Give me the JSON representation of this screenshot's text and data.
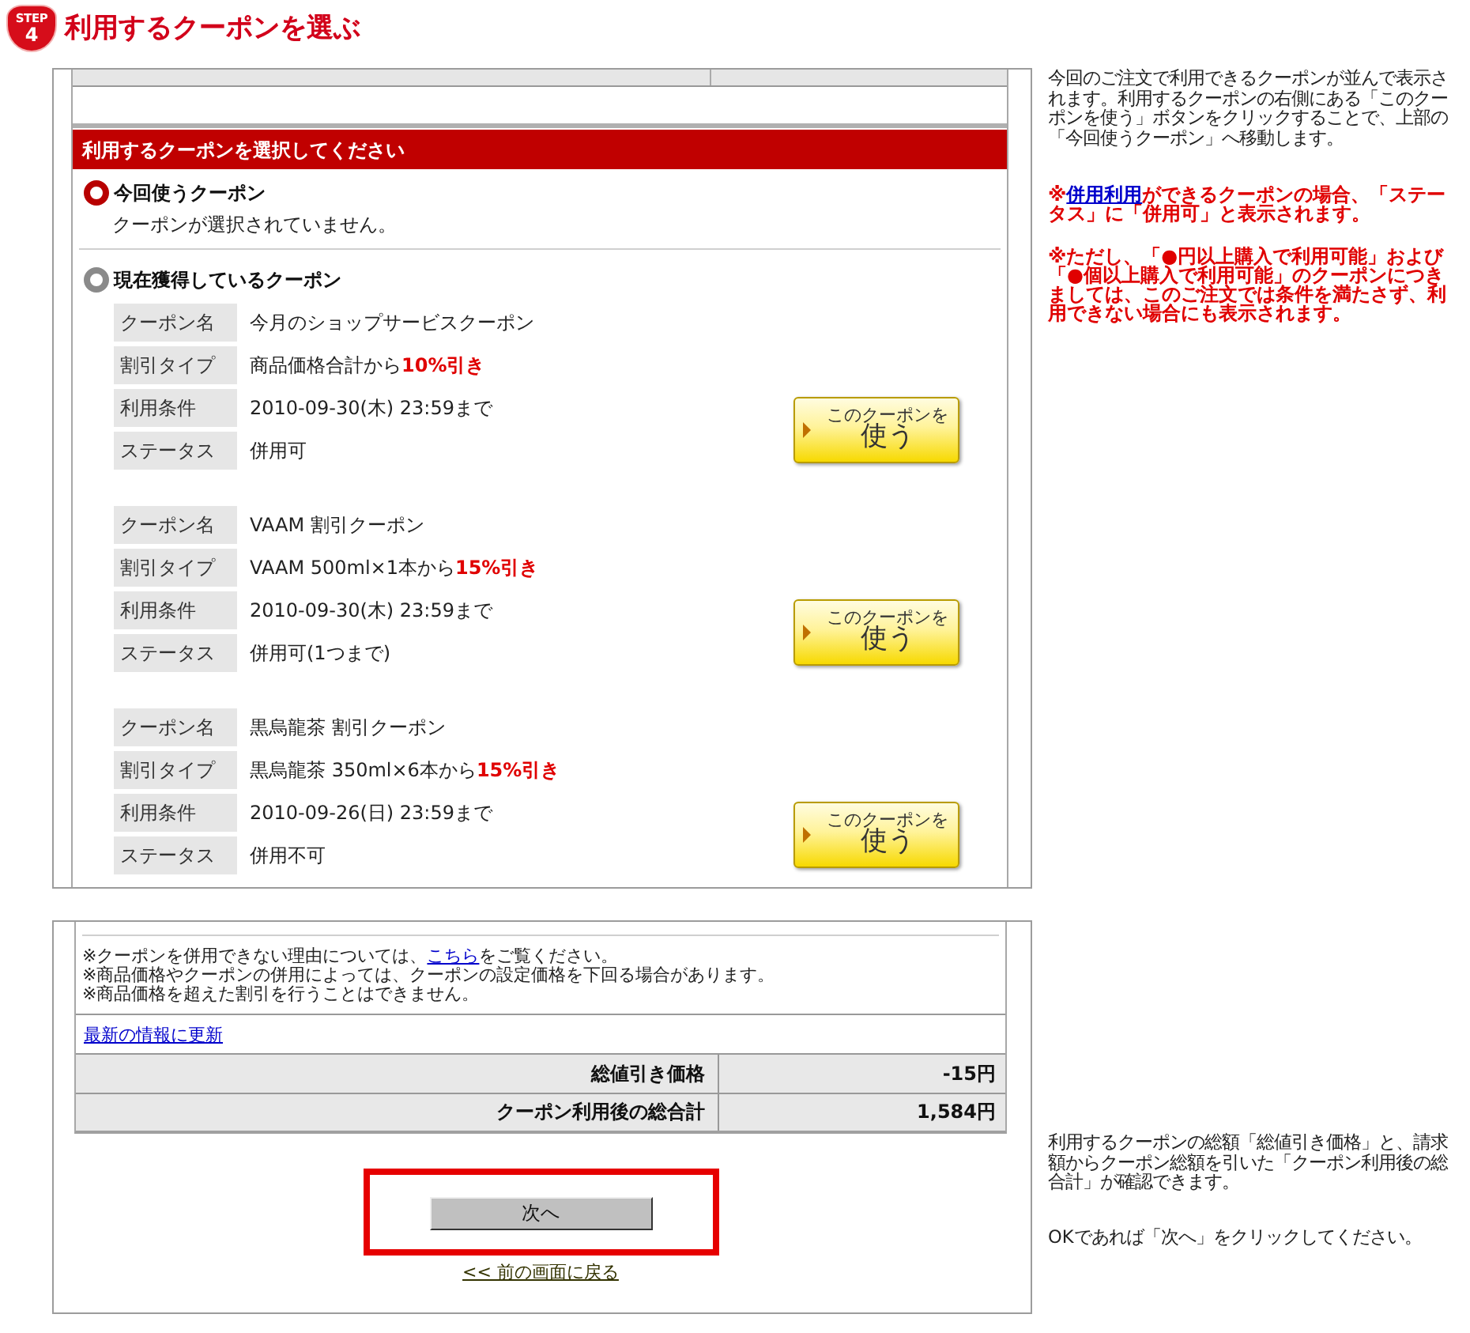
{
  "step": {
    "label": "STEP",
    "number": "4"
  },
  "title": "利用するクーポンを選ぶ",
  "coupon_panel": {
    "header": "利用するクーポンを選択してください",
    "options": [
      {
        "label": "今回使うクーポン",
        "selected": true,
        "message": "クーポンが選択されていません。"
      },
      {
        "label": "現在獲得しているクーポン",
        "selected": false,
        "coupons": [
          {
            "fields": [
              {
                "label": "クーポン名",
                "value": "今月のショップサービスクーポン"
              },
              {
                "label": "割引タイプ",
                "value": "商品価格合計から**10%引き**"
              },
              {
                "label": "利用条件",
                "value": "2010-09-30(木) 23:59まで"
              },
              {
                "label": "ステータス",
                "value": "併用可"
              }
            ],
            "button_lines": [
              "このクーポンを",
              "使う"
            ]
          },
          {
            "fields": [
              {
                "label": "クーポン名",
                "value": "VAAM 割引クーポン"
              },
              {
                "label": "割引タイプ",
                "value": "VAAM 500ml×1本から**15%引き**"
              },
              {
                "label": "利用条件",
                "value": "2010-09-30(木) 23:59まで"
              },
              {
                "label": "ステータス",
                "value": "併用可(1つまで)"
              }
            ],
            "button_lines": [
              "このクーポンを",
              "使う"
            ]
          },
          {
            "fields": [
              {
                "label": "クーポン名",
                "value": "黒烏龍茶 割引クーポン"
              },
              {
                "label": "割引タイプ",
                "value": "黒烏龍茶 350ml×6本から**15%引き**"
              },
              {
                "label": "利用条件",
                "value": "2010-09-26(日) 23:59まで"
              },
              {
                "label": "ステータス",
                "value": "併用不可"
              }
            ],
            "button_lines": [
              "このクーポンを",
              "使う"
            ]
          }
        ]
      }
    ]
  },
  "summary_panel": {
    "notes": [
      {
        "before": "※クーポンを併用できない理由については、",
        "link": "こちら",
        "after": "をご覧ください。"
      },
      {
        "text": "※商品価格やクーポンの併用によっては、クーポンの設定価格を下回る場合があります。"
      },
      {
        "text": "※商品価格を超えた割引を行うことはできません。"
      }
    ],
    "refresh_link": "最新の情報に更新",
    "totals": [
      {
        "label": "総値引き価格",
        "value": "-15円"
      },
      {
        "label": "クーポン利用後の総合計",
        "value": "1,584円"
      }
    ],
    "next_button": "次へ",
    "back_link": "<< 前の画面に戻る"
  },
  "help": {
    "upper": [
      {
        "kind": "plain",
        "text": "今回のご注文で利用できるクーポンが並んで表示されます。利用するクーポンの右側にある「このクーポンを使う」ボタンをクリックすることで、上部の「今回使うクーポン」へ移動します。"
      },
      {
        "kind": "warning",
        "before": "※",
        "link": "併用利用",
        "after": "ができるクーポンの場合、「ステータス」に「併用可」と表示されます。"
      },
      {
        "kind": "warning",
        "text": "※ただし、「●円以上購入で利用可能」および「●個以上購入で利用可能」のクーポンにつきましては、このご注文では条件を満たさず、利用できない場合にも表示されます。"
      }
    ],
    "lower": [
      {
        "kind": "plain",
        "text": "利用するクーポンの総額「総値引き価格」と、請求額からクーポン総額を引いた「クーポン利用後の総合計」が確認できます。"
      },
      {
        "kind": "plain",
        "text": "OKであれば「次へ」をクリックしてください。"
      }
    ]
  }
}
